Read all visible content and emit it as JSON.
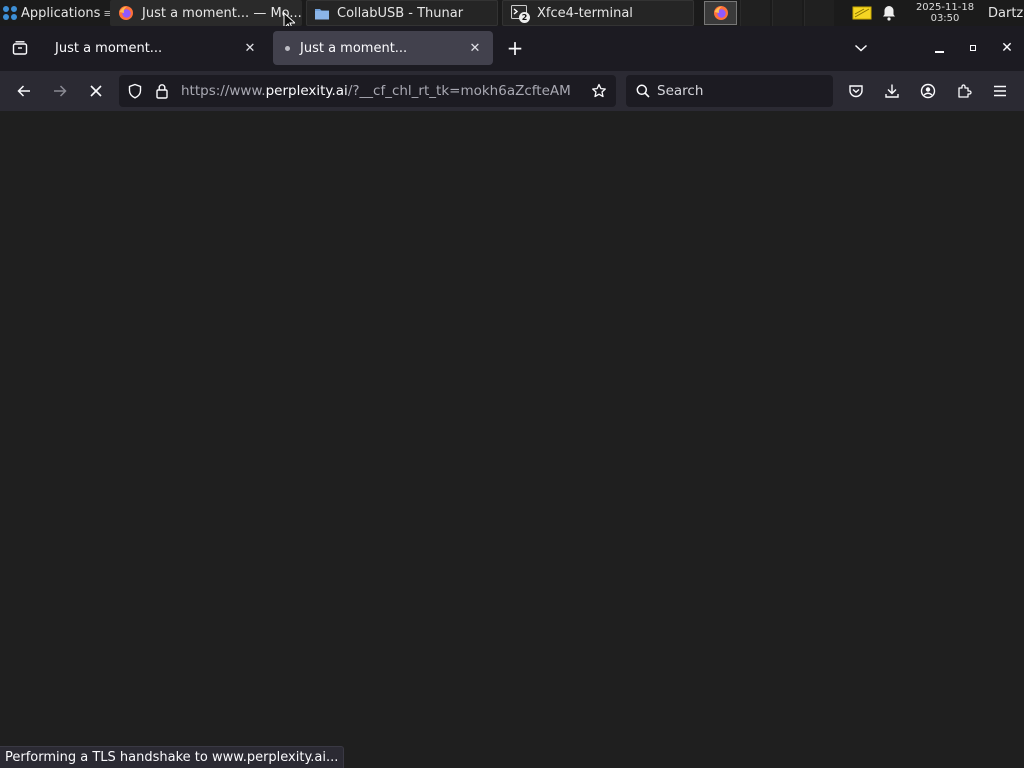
{
  "panel": {
    "applications_label": "Applications",
    "tasks": [
      {
        "label": "Just a moment... — Mo...",
        "icon": "firefox-icon"
      },
      {
        "label": "CollabUSB - Thunar",
        "icon": "folder-icon"
      },
      {
        "label": "Xfce4-terminal",
        "icon": "terminal-icon",
        "badge": "2"
      }
    ],
    "clock_date": "2025-11-18",
    "clock_time": "03:50",
    "user": "Dartz"
  },
  "browser": {
    "tabs": [
      {
        "title": "Just a moment...",
        "active": false
      },
      {
        "title": "Just a moment...",
        "active": true,
        "loading": true
      }
    ],
    "url": {
      "prefix": "https://www.",
      "host": "perplexity.ai",
      "rest": "/?__cf_chl_rt_tk=mokh6aZcfteAM"
    },
    "search_placeholder": "Search",
    "status_text": "Performing a TLS handshake to www.perplexity.ai..."
  },
  "colors": {
    "panel_bg": "#1b1b1b",
    "tabstrip_bg": "#1c1b22",
    "active_tab_bg": "#42414d",
    "toolbar_bg": "#2b2a33",
    "field_bg": "#1c1b22",
    "content_bg": "#1f1f1f"
  }
}
